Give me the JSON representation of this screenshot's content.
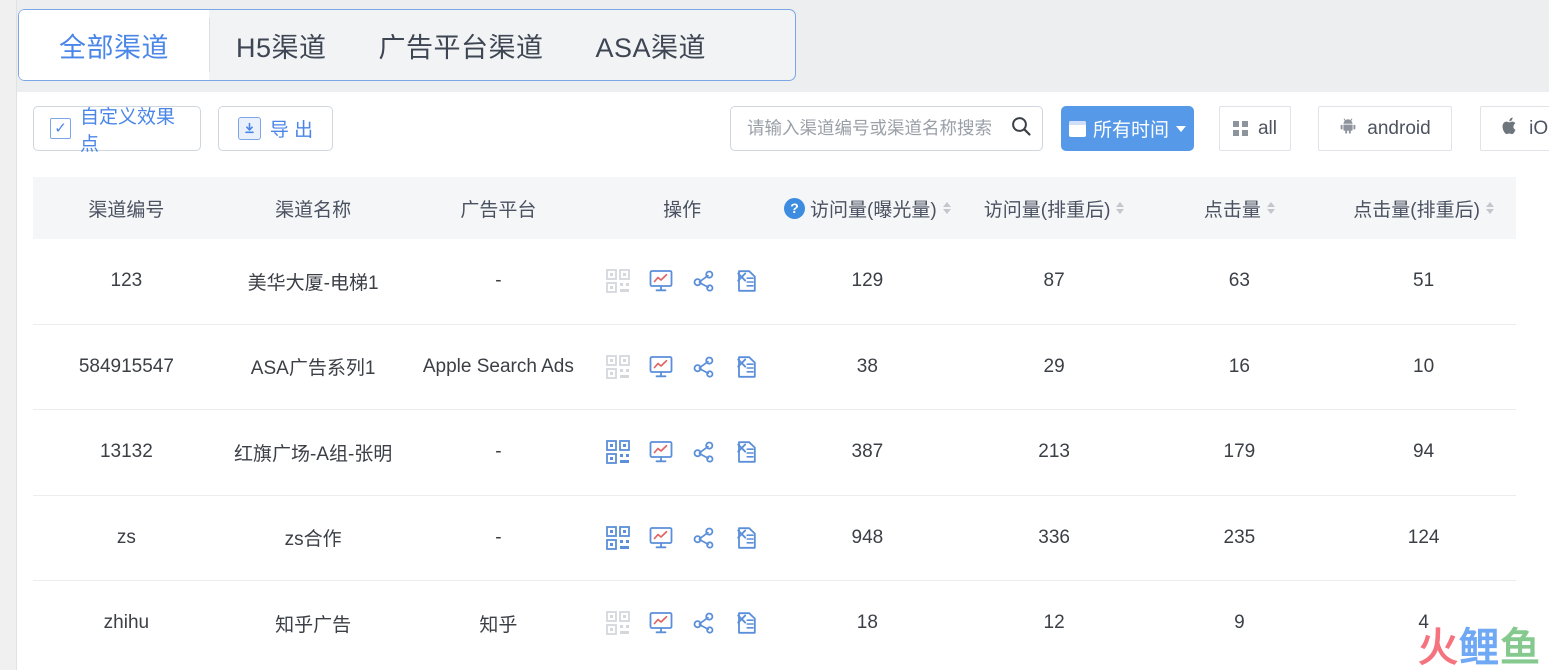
{
  "tabs": [
    {
      "label": "全部渠道",
      "active": true
    },
    {
      "label": "H5渠道",
      "active": false
    },
    {
      "label": "广告平台渠道",
      "active": false
    },
    {
      "label": "ASA渠道",
      "active": false
    }
  ],
  "toolbar": {
    "custom_effect_label": "自定义效果点",
    "export_label": "导 出",
    "search_placeholder": "请输入渠道编号或渠道名称搜索",
    "search_value": "",
    "date_label": "所有时间",
    "platform_all": "all",
    "platform_android": "android",
    "platform_ios": "iOS"
  },
  "table": {
    "columns": [
      {
        "label": "渠道编号",
        "sortable": false,
        "help": false
      },
      {
        "label": "渠道名称",
        "sortable": false,
        "help": false
      },
      {
        "label": "广告平台",
        "sortable": false,
        "help": false
      },
      {
        "label": "操作",
        "sortable": false,
        "help": false
      },
      {
        "label": "访问量(曝光量)",
        "sortable": true,
        "help": true
      },
      {
        "label": "访问量(排重后)",
        "sortable": true,
        "help": false
      },
      {
        "label": "点击量",
        "sortable": true,
        "help": false
      },
      {
        "label": "点击量(排重后)",
        "sortable": true,
        "help": false
      }
    ],
    "rows": [
      {
        "code": "123",
        "name": "美华大厦-电梯1",
        "platform": "-",
        "qr_enabled": false,
        "visits": "129",
        "visits_dedup": "87",
        "clicks": "63",
        "clicks_dedup": "51"
      },
      {
        "code": "584915547",
        "name": "ASA广告系列1",
        "platform": "Apple Search Ads",
        "qr_enabled": false,
        "visits": "38",
        "visits_dedup": "29",
        "clicks": "16",
        "clicks_dedup": "10"
      },
      {
        "code": "13132",
        "name": "红旗广场-A组-张明",
        "platform": "-",
        "qr_enabled": true,
        "visits": "387",
        "visits_dedup": "213",
        "clicks": "179",
        "clicks_dedup": "94"
      },
      {
        "code": "zs",
        "name": "zs合作",
        "platform": "-",
        "qr_enabled": true,
        "visits": "948",
        "visits_dedup": "336",
        "clicks": "235",
        "clicks_dedup": "124"
      },
      {
        "code": "zhihu",
        "name": "知乎广告",
        "platform": "知乎",
        "qr_enabled": false,
        "visits": "18",
        "visits_dedup": "12",
        "clicks": "9",
        "clicks_dedup": "4"
      }
    ],
    "row_action_icons": [
      "qr-code-icon",
      "trend-monitor-icon",
      "share-icon",
      "excel-export-icon"
    ]
  },
  "watermark": {
    "char1": "火",
    "char2": "鲤",
    "char3": "鱼"
  },
  "colors": {
    "accent": "#4a86e8",
    "primary_button": "#5599e8",
    "tab_border": "#7ba7e8",
    "header_bg": "#f5f6f7",
    "icon_blue": "#5b8fd9",
    "icon_gray": "#d4d8dd",
    "icon_red": "#e06464"
  }
}
